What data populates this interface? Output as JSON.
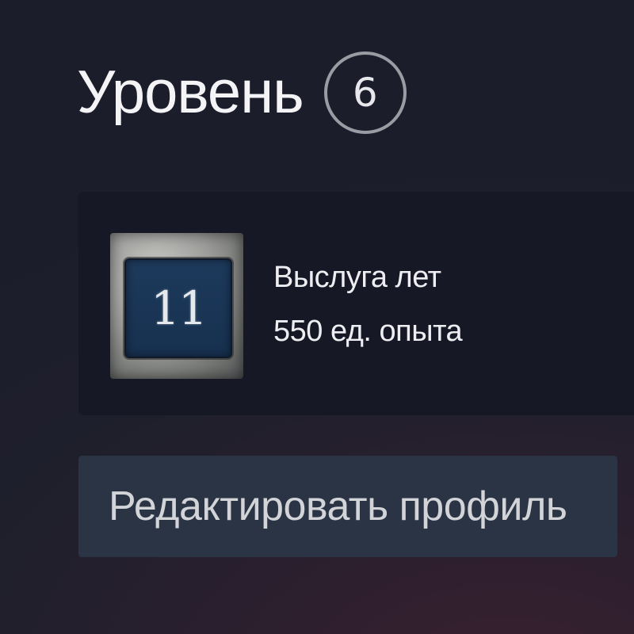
{
  "level": {
    "title": "Уровень",
    "value": "6"
  },
  "badge": {
    "icon_number": "11",
    "name": "Выслуга лет",
    "xp": "550 ед. опыта"
  },
  "actions": {
    "edit_profile_label": "Редактировать профиль"
  },
  "colors": {
    "background": "#1f1f2c",
    "panel": "#171826",
    "button": "#2a3445",
    "level_ring": "#9b9ba3",
    "badge_plate": "#1d3a5c"
  }
}
